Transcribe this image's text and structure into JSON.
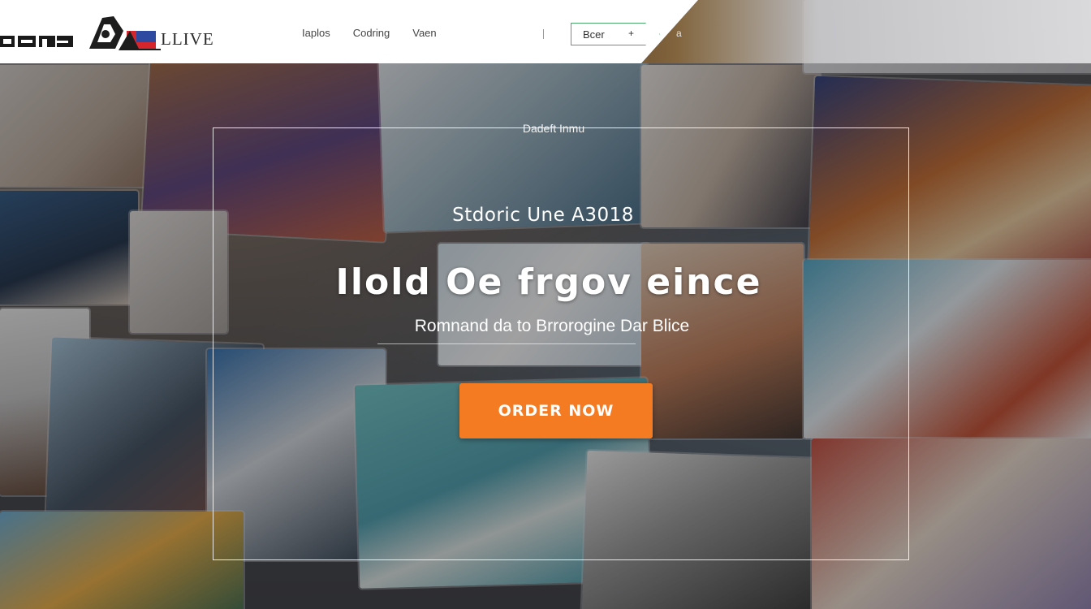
{
  "header": {
    "brand_text": "LLIVE",
    "nav_items": [
      {
        "label": "Iaplos"
      },
      {
        "label": "Codring"
      },
      {
        "label": "Vaen"
      }
    ],
    "cta_label": "Bcer",
    "cta_arrow": "+",
    "extra_label": "a"
  },
  "hero": {
    "caption": "Dadeft Inmu",
    "subtitle": "Stdoric Une A3018",
    "title": "Ilold Oe frgov eince",
    "tagline": "Romnand da to Brrorogine Dar Blice",
    "button_label": "ORDER  NOW"
  },
  "colors": {
    "accent": "#f47b22",
    "cta_border": "#4aa86a",
    "header_bg": "#ffffff"
  },
  "icons": {
    "logo": "brand-emblem-icon",
    "left_mark": "brand-wordmark-icon",
    "cta_arrow": "arrow-icon"
  }
}
